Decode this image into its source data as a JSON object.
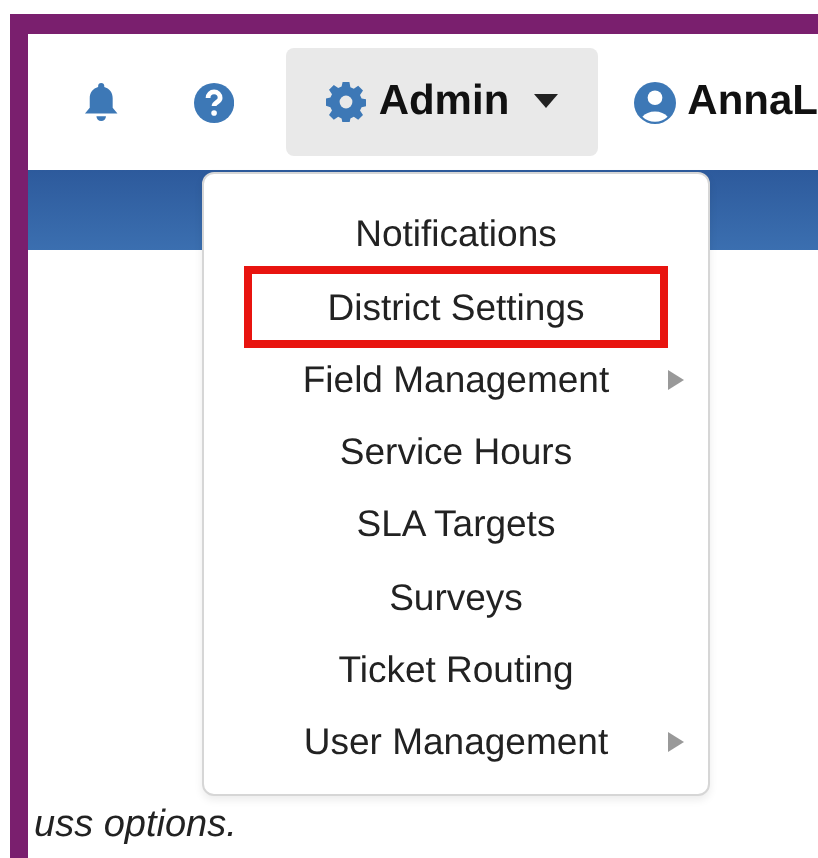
{
  "navbar": {
    "admin_menu": {
      "label": "Admin",
      "expanded": true
    },
    "user": {
      "name": "AnnaL"
    }
  },
  "menu_items": [
    {
      "label": "Notifications",
      "has_submenu": false,
      "highlighted": false
    },
    {
      "label": "District Settings",
      "has_submenu": false,
      "highlighted": true
    },
    {
      "label": "Field Management",
      "has_submenu": true,
      "highlighted": false
    },
    {
      "label": "Service Hours",
      "has_submenu": false,
      "highlighted": false
    },
    {
      "label": "SLA Targets",
      "has_submenu": false,
      "highlighted": false
    },
    {
      "label": "Surveys",
      "has_submenu": false,
      "highlighted": false
    },
    {
      "label": "Ticket Routing",
      "has_submenu": false,
      "highlighted": false
    },
    {
      "label": "User Management",
      "has_submenu": true,
      "highlighted": false
    }
  ],
  "body_text": "uss options."
}
